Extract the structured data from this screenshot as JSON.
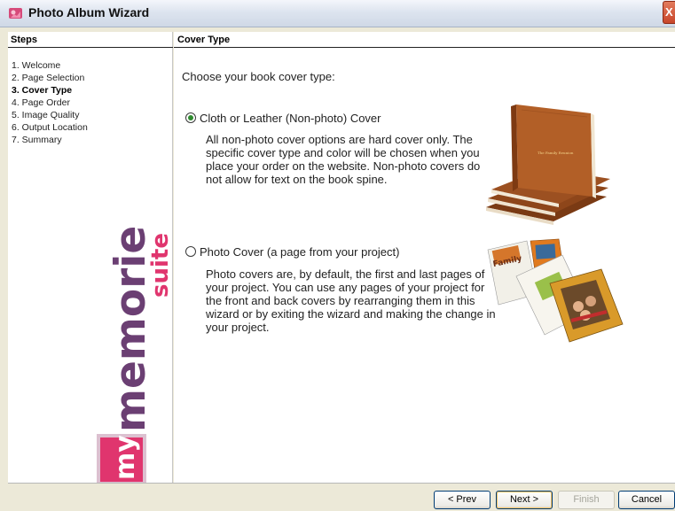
{
  "window": {
    "title": "Photo Album Wizard",
    "close_label": "X",
    "icon": "photo-album-icon"
  },
  "steps": {
    "header": "Steps",
    "items": [
      {
        "label": "1. Welcome",
        "active": false
      },
      {
        "label": "2. Page Selection",
        "active": false
      },
      {
        "label": "3. Cover Type",
        "active": true
      },
      {
        "label": "4. Page Order",
        "active": false
      },
      {
        "label": "5. Image Quality",
        "active": false
      },
      {
        "label": "6. Output Location",
        "active": false
      },
      {
        "label": "7. Summary",
        "active": false
      }
    ]
  },
  "logo": {
    "brand_main": "memories",
    "brand_accent": "suite",
    "brand_prefix": "my",
    "colors": {
      "main": "#6b3f73",
      "accent": "#e0356e",
      "box": "#e0356e",
      "box_border": "#c8a0b8"
    }
  },
  "content": {
    "header": "Cover Type",
    "prompt": "Choose your book cover type:",
    "options": [
      {
        "label": "Cloth or Leather (Non-photo) Cover",
        "selected": true,
        "description": "All non-photo cover options are hard cover only. The specific cover type and color will be chosen when you place your order on the website. Non-photo covers do not allow for text on the book spine.",
        "image": "leather-book-stack-image"
      },
      {
        "label": "Photo Cover (a page from your project)",
        "selected": false,
        "description": "Photo covers are, by default, the first and last pages of your project. You can use any pages of your project for the front and back covers by rearranging them in this wizard or by exiting the wizard and making the change in your project.",
        "image": "photo-cover-books-image"
      }
    ]
  },
  "buttons": {
    "prev": "< Prev",
    "next": "Next >",
    "finish": "Finish",
    "cancel": "Cancel"
  }
}
